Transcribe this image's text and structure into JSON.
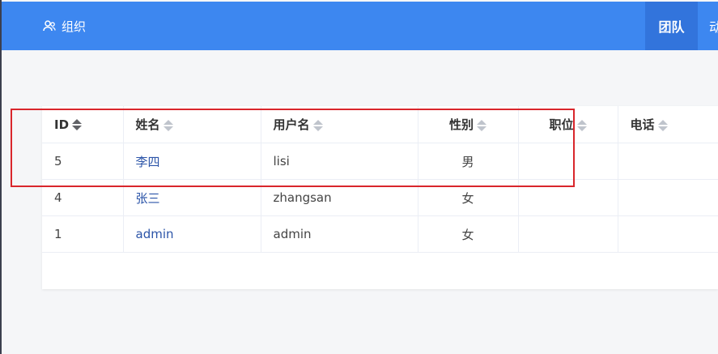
{
  "topbar": {
    "org_label": "组织",
    "team_tab": "团队",
    "next_tab": "动"
  },
  "table": {
    "headers": [
      "ID",
      "姓名",
      "用户名",
      "性别",
      "职位",
      "电话"
    ],
    "rows": [
      {
        "id": "5",
        "name": "李四",
        "username": "lisi",
        "gender": "男",
        "position": "",
        "phone": ""
      },
      {
        "id": "4",
        "name": "张三",
        "username": "zhangsan",
        "gender": "女",
        "position": "",
        "phone": ""
      },
      {
        "id": "1",
        "name": "admin",
        "username": "admin",
        "gender": "女",
        "position": "",
        "phone": ""
      }
    ]
  },
  "colors": {
    "brand": "#3d87f0",
    "active_tab": "#3274dc",
    "link": "#2b54a8",
    "highlight": "#d9262c"
  }
}
